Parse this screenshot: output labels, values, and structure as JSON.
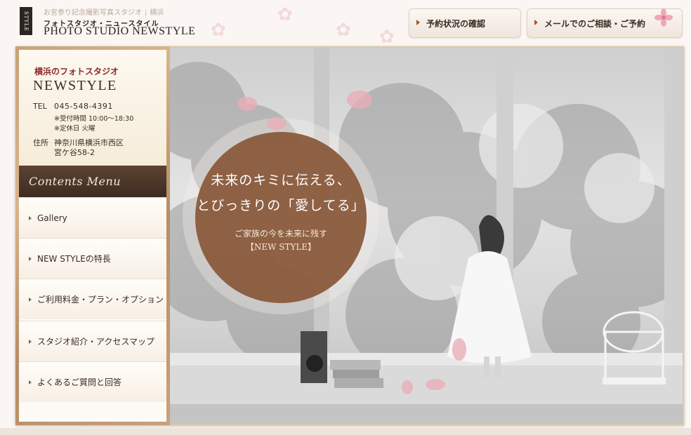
{
  "header": {
    "tagline": "お宮参り記念撮影写真スタジオ",
    "location": "横浜",
    "logo_text": "STYLE",
    "kana_name": "フォトスタジオ・ニュースタイル",
    "studio_name": "PHOTO STUDIO NEWSTYLE",
    "buttons": {
      "status": "予約状況の確認",
      "contact": "メールでのご相談・ご予約"
    }
  },
  "sidebar": {
    "subtitle": "横浜のフォトスタジオ",
    "title": "NEWSTYLE",
    "tel_label": "TEL",
    "tel": "045-548-4391",
    "hours": "※受付時間 10:00～18:30",
    "closed": "※定休日 火曜",
    "address_label": "住所",
    "address_line1": "神奈川県横浜市西区",
    "address_line2": "宮ケ谷58-2",
    "menu_heading": "Contents Menu",
    "menu": [
      {
        "label": "Gallery"
      },
      {
        "label": "NEW STYLEの特長"
      },
      {
        "label": "ご利用料金・プラン・オプション"
      },
      {
        "label": "スタジオ紹介・アクセスマップ"
      },
      {
        "label": "よくあるご質問と回答"
      }
    ]
  },
  "hero": {
    "line1": "未来のキミに伝える、",
    "line2": "とびっきりの「愛してる」",
    "line3": "ご家族の今を未来に残す",
    "line4": "【NEW STYLE】"
  },
  "colors": {
    "circle": "#8a5a3c",
    "menu_head": "#4a3527",
    "accent_red": "#8c2a2a",
    "button_arrow": "#b0522c"
  }
}
